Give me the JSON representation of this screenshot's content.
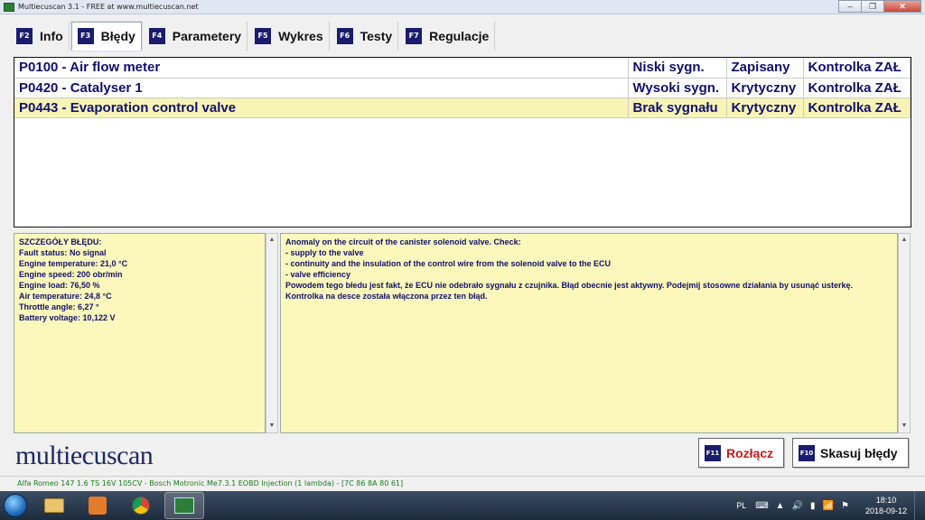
{
  "window": {
    "title": "Multiecuscan 3.1 - FREE at www.multiecuscan.net",
    "minimize": "–",
    "maximize": "❐",
    "close": "✕"
  },
  "tabs": [
    {
      "key": "F2",
      "label": "Info",
      "icon": "f2-key-icon"
    },
    {
      "key": "F3",
      "label": "Błędy",
      "icon": "f3-key-icon",
      "active": true
    },
    {
      "key": "F4",
      "label": "Parametery",
      "icon": "f4-key-icon"
    },
    {
      "key": "F5",
      "label": "Wykres",
      "icon": "f5-key-icon"
    },
    {
      "key": "F6",
      "label": "Testy",
      "icon": "f6-key-icon"
    },
    {
      "key": "F7",
      "label": "Regulacje",
      "icon": "f7-key-icon"
    }
  ],
  "faults": [
    {
      "code": "P0100 - Air flow meter",
      "signal": "Niski sygn.",
      "state": "Zapisany",
      "lamp": "Kontrolka ZAŁ"
    },
    {
      "code": "P0420 - Catalyser 1",
      "signal": "Wysoki sygn.",
      "state": "Krytyczny",
      "lamp": "Kontrolka ZAŁ"
    },
    {
      "code": "P0443 - Evaporation control valve",
      "signal": "Brak sygnału",
      "state": "Krytyczny",
      "lamp": "Kontrolka ZAŁ",
      "selected": true
    }
  ],
  "details": {
    "lines": [
      "SZCZEGÓŁY BŁĘDU:",
      "Fault status: No signal",
      "Engine temperature: 21,0 °C",
      "Engine speed: 200 obr/min",
      "Engine load: 76,50 %",
      "Air temperature: 24,8 °C",
      "Throttle angle: 6,27 °",
      "Battery voltage: 10,122 V"
    ]
  },
  "description": {
    "lines": [
      "Anomaly on the circuit of the canister solenoid valve. Check:",
      "- supply to the valve",
      "- continuity and the insulation of the control wire from the solenoid valve to the ECU",
      "- valve efficiency",
      "Powodem tego błedu jest fakt, że ECU nie odebrało sygnału z czujnika. Błąd obecnie jest aktywny. Podejmij stosowne działania by usunąć usterkę. Kontrolka na desce została włączona przez ten błąd."
    ]
  },
  "brand": "multiecuscan",
  "buttons": {
    "disconnect": {
      "key": "F11",
      "label": "Rozłącz",
      "color": "#c81a1a"
    },
    "clear": {
      "key": "F10",
      "label": "Skasuj błędy"
    }
  },
  "status_line": "Alfa Romeo 147 1.6 TS 16V 105CV - Bosch Motronic Me7.3.1 EOBD Injection (1 lambda) - [7C 86 8A 80 61]",
  "taskbar": {
    "language": "PL",
    "time": "18:10",
    "date": "2018-09-12"
  },
  "colors": {
    "fkey_bg": "#1a1c6e",
    "selected_row": "#f7f4b5",
    "detail_bg": "#fbf8bb",
    "fault_text": "#11116e",
    "status_text": "#1a7a1a"
  }
}
